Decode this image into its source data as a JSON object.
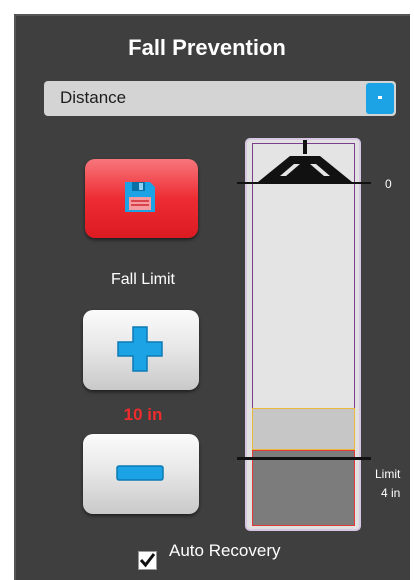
{
  "title": "Fall Prevention",
  "mode_select": {
    "value": "Distance"
  },
  "controls": {
    "save_icon": "floppy-disk-icon",
    "fall_limit_label": "Fall Limit",
    "fall_limit_value": "10 in",
    "plus_icon": "plus-icon",
    "minus_icon": "minus-icon"
  },
  "gauge": {
    "zero_label": "0",
    "limit_label": "Limit",
    "limit_value": "4 in",
    "colors": {
      "frame": "#7d3d8e",
      "warning": "#e8b93a",
      "danger": "#e23a3a"
    }
  },
  "auto_recovery": {
    "label": "Auto Recovery",
    "checked": true
  },
  "colors": {
    "accent": "#1ba3e6",
    "save": "#ee2c33",
    "limit_text": "#ee2c2c"
  }
}
